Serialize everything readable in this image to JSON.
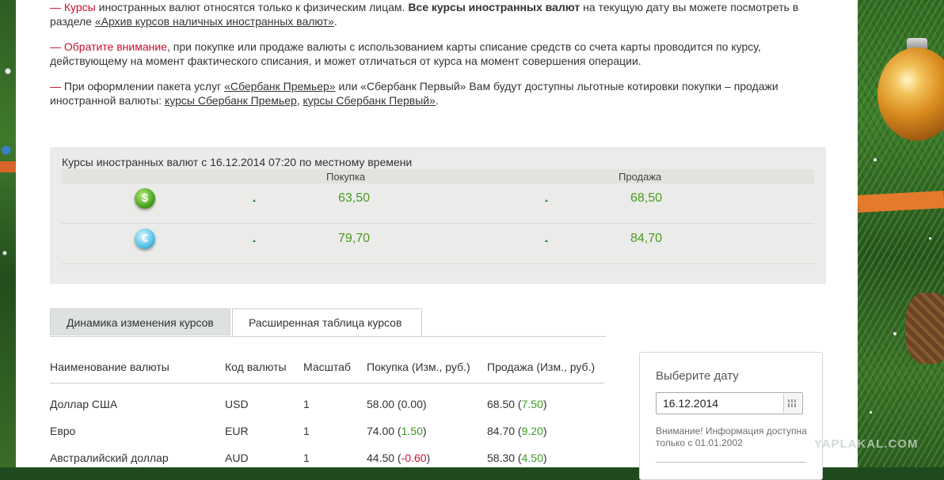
{
  "notes": {
    "p1": {
      "lead": "— Курсы",
      "text1": " иностранных валют относятся только к физическим лицам. ",
      "bold": "Все курсы иностранных валют",
      "text2": " на текущую дату вы можете посмотреть в разделе ",
      "link": "«Архив курсов наличных иностранных валют»",
      "tail": "."
    },
    "p2": {
      "lead": "— Обратите внимание",
      "text": ", при покупке или продаже валюты с использованием карты списание средств со счета карты проводится по курсу, действующему на момент фактического списания, и может отличаться от курса на момент совершения операции."
    },
    "p3": {
      "lead": "—",
      "text1": " При оформлении пакета услуг ",
      "link1": "«Сбербанк Премьер»",
      "text2": " или «Сбербанк Первый» Вам будут доступны льготные котировки покупки – продажи иностранной валюты: ",
      "link2": "курсы Сбербанк Премьер",
      "sep": ", ",
      "link3": "курсы Сбербанк Первый»",
      "tail": "."
    }
  },
  "rates": {
    "title": "Курсы иностранных валют с 16.12.2014 07:20 по местному времени",
    "buy_header": "Покупка",
    "sell_header": "Продажа",
    "rows": [
      {
        "icon": "dollar-coin-icon",
        "symbol": "$",
        "buy": "63,50",
        "sell": "68,50"
      },
      {
        "icon": "euro-coin-icon",
        "symbol": "€",
        "buy": "79,70",
        "sell": "84,70"
      }
    ]
  },
  "tabs": [
    {
      "label": "Динамика изменения курсов",
      "active": false
    },
    {
      "label": "Расширенная таблица курсов",
      "active": true
    }
  ],
  "table": {
    "headers": [
      "Наименование валюты",
      "Код валюты",
      "Масштаб",
      "Покупка (Изм., руб.)",
      "Продажа (Изм., руб.)"
    ],
    "rows": [
      {
        "name": "Доллар США",
        "code": "USD",
        "scale": "1",
        "buy": "58.00",
        "buy_chg": "0.00",
        "sell": "68.50",
        "sell_chg": "7.50"
      },
      {
        "name": "Евро",
        "code": "EUR",
        "scale": "1",
        "buy": "74.00",
        "buy_chg": "1.50",
        "sell": "84.70",
        "sell_chg": "9.20"
      },
      {
        "name": "Австралийский доллар",
        "code": "AUD",
        "scale": "1",
        "buy": "44.50",
        "buy_chg": "-0.60",
        "sell": "58.30",
        "sell_chg": "4.50"
      }
    ]
  },
  "datepicker": {
    "label": "Выберите дату",
    "value": "16.12.2014",
    "note": "Внимание! Информация доступна только с 01.01.2002"
  },
  "watermark": "YAPLAKAL.COM",
  "colors": {
    "accent_red": "#c8102e",
    "rate_green": "#4a9c1f",
    "positive": "#3c9a1f",
    "negative": "#c8102e"
  }
}
